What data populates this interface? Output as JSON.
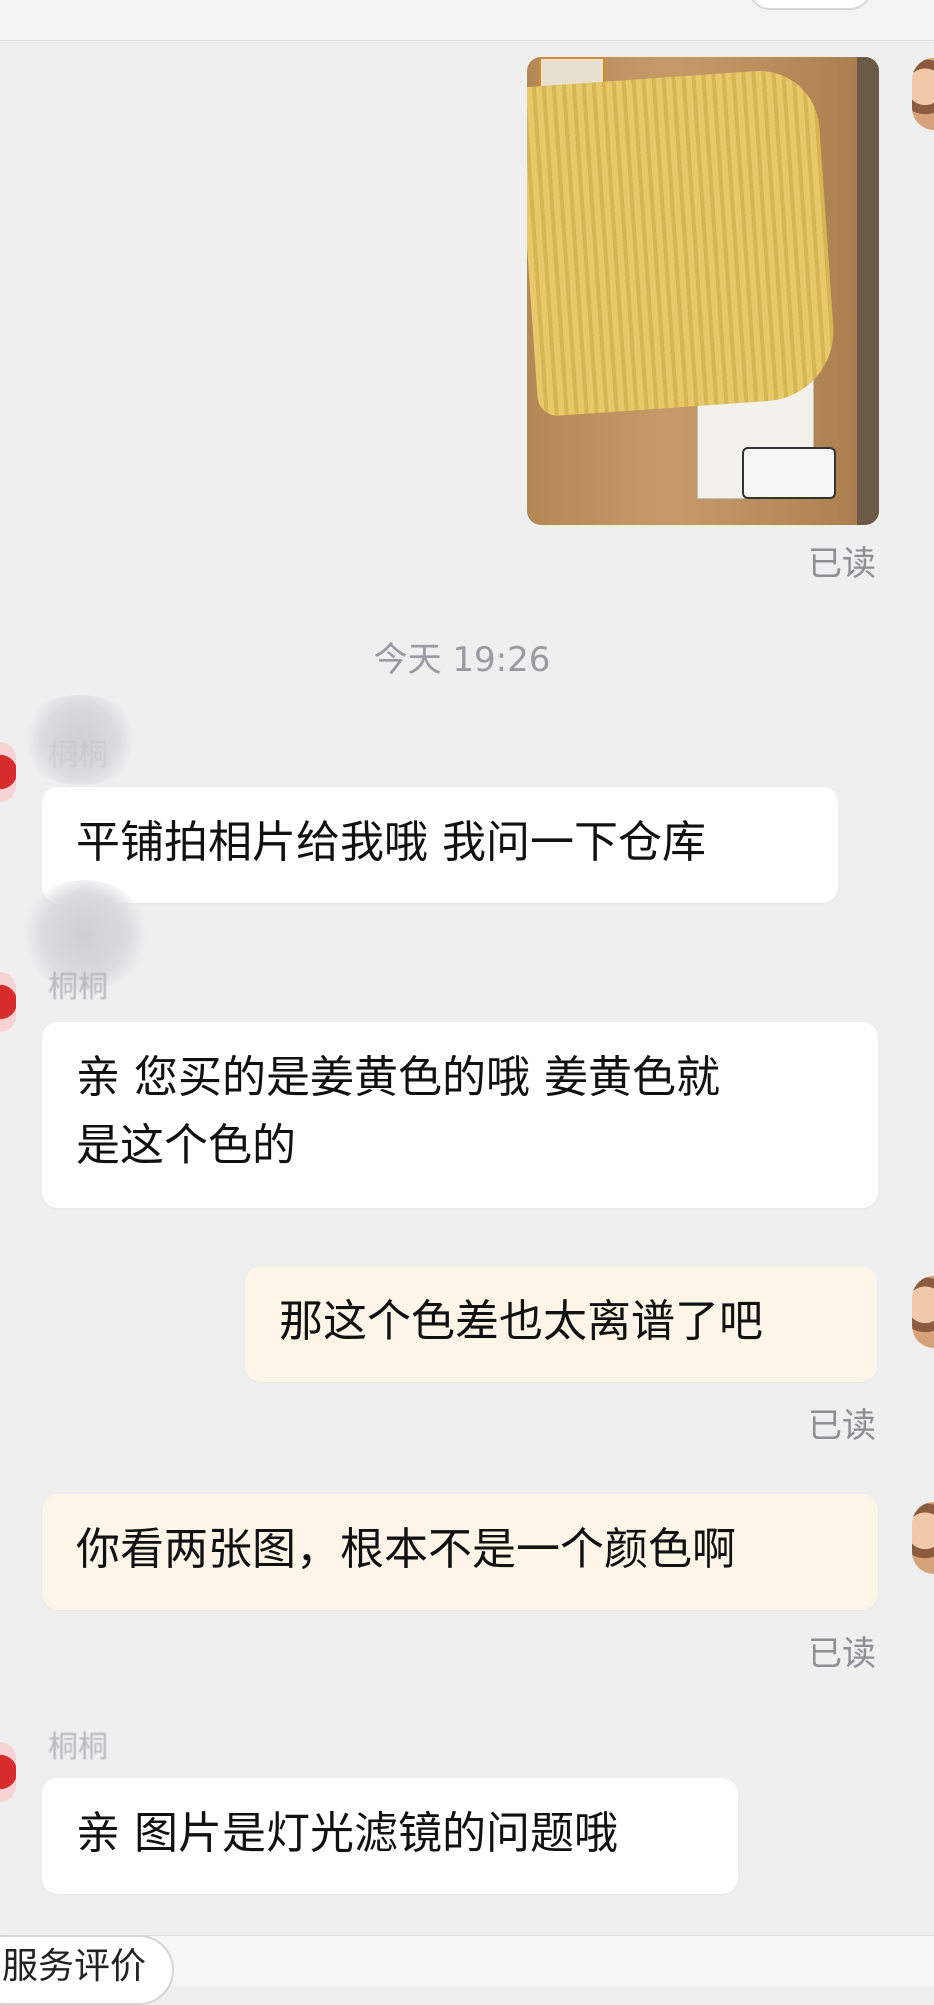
{
  "messages": [
    {
      "type": "image",
      "side": "right",
      "status": "已读"
    },
    {
      "type": "time",
      "text": "今天 19:26"
    },
    {
      "type": "text",
      "side": "left",
      "sender": "桐桐",
      "text": "平铺拍相片给我哦 我问一下仓库"
    },
    {
      "type": "text",
      "side": "left",
      "sender": "桐桐",
      "line1": "亲 您买的是姜黄色的哦 姜黄色就",
      "line2": "是这个色的"
    },
    {
      "type": "text",
      "side": "right",
      "text": "那这个色差也太离谱了吧",
      "status": "已读"
    },
    {
      "type": "text",
      "side": "right",
      "text": "你看两张图，根本不是一个颜色啊",
      "status": "已读"
    },
    {
      "type": "text",
      "side": "left",
      "sender": "桐桐",
      "text": "亲 图片是灯光滤镜的问题哦"
    }
  ],
  "bottom": {
    "service_eval": "服务评价"
  },
  "colors": {
    "background": "#efeff0",
    "bubble_other": "#ffffff",
    "bubble_mine": "#fdf6e8",
    "read_status": "#8e8e93"
  }
}
